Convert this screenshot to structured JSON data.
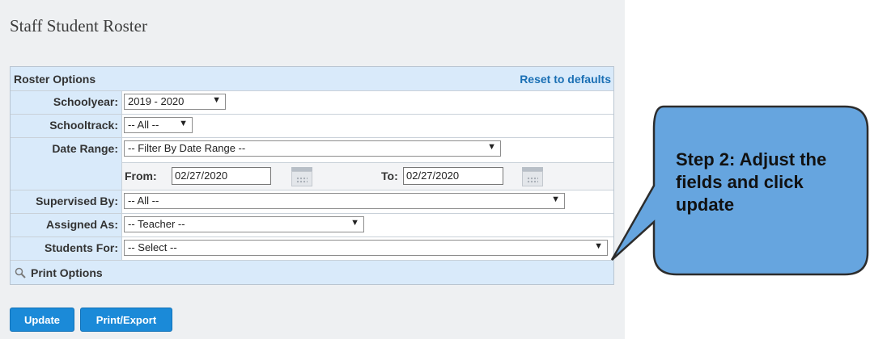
{
  "page": {
    "title": "Staff Student Roster"
  },
  "roster_options": {
    "title": "Roster Options",
    "reset_label": "Reset to defaults",
    "schoolyear": {
      "label": "Schoolyear:",
      "value": "2019 - 2020"
    },
    "schooltrack": {
      "label": "Schooltrack:",
      "value": "-- All --"
    },
    "date_range": {
      "label": "Date Range:",
      "value": "-- Filter By Date Range --",
      "from_label": "From:",
      "from_value": "02/27/2020",
      "to_label": "To:",
      "to_value": "02/27/2020"
    },
    "supervised_by": {
      "label": "Supervised By:",
      "value": "-- All --"
    },
    "assigned_as": {
      "label": "Assigned As:",
      "value": "-- Teacher --"
    },
    "students_for": {
      "label": "Students For:",
      "value": "-- Select --"
    },
    "print_options_label": "Print Options"
  },
  "buttons": {
    "update_label": "Update",
    "print_export_label": "Print/Export"
  },
  "callout": {
    "text": "Step 2: Adjust the fields and click update"
  },
  "icons": {
    "dropdown": "▼",
    "date_picker": "calendar-icon",
    "print_options": "magnifier-icon"
  },
  "colors": {
    "header_bg": "#d9eafa",
    "link": "#1a6fb4",
    "button": "#1b8ad8",
    "callout_fill": "#66a5df",
    "callout_stroke": "#2c2c2c"
  }
}
